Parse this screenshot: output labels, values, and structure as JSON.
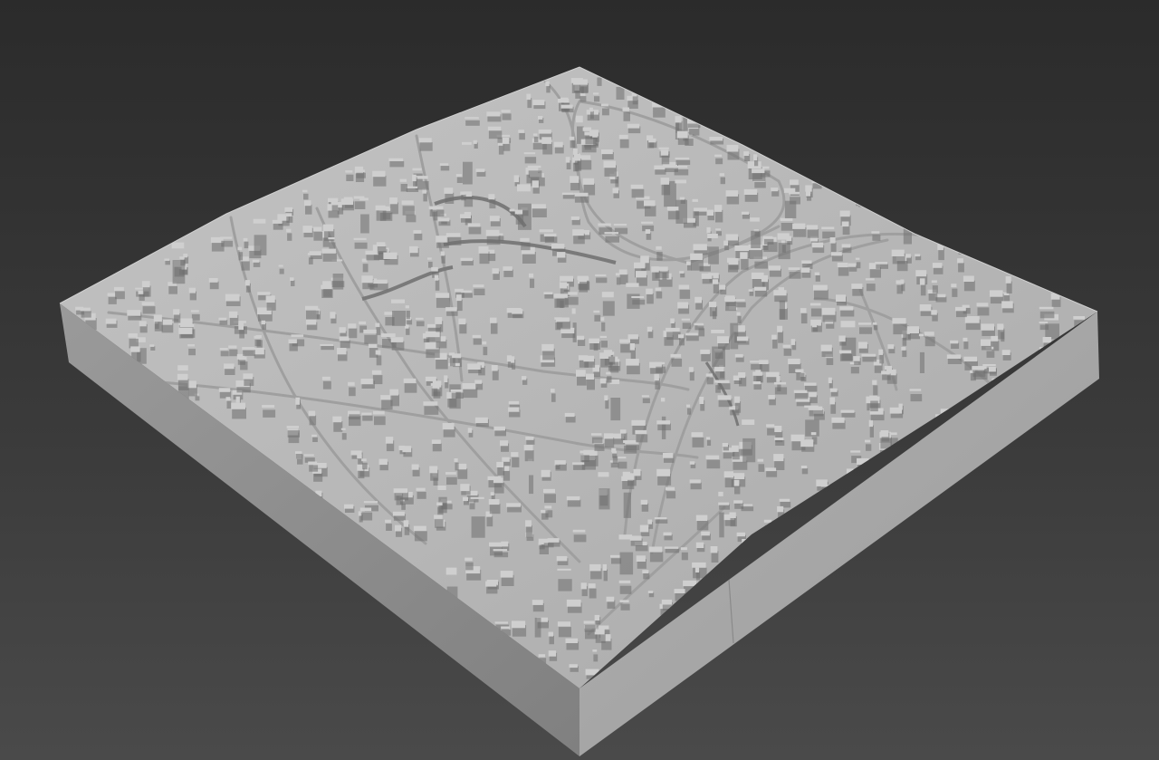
{
  "scene": {
    "viewport_name": "3d-viewport",
    "object_name": "city-terrain-model",
    "colors": {
      "background_top": "#2b2b2b",
      "background_bottom": "#4a4a4a",
      "top_surface": "#b3b3b3",
      "top_surface_highlight": "#c1c1c1",
      "left_side": "#8e8e8e",
      "right_side": "#a6a6a6",
      "building": "#cfcfcf",
      "building_shadow": "#6f6f6f",
      "road": "#a3a3a3"
    }
  }
}
